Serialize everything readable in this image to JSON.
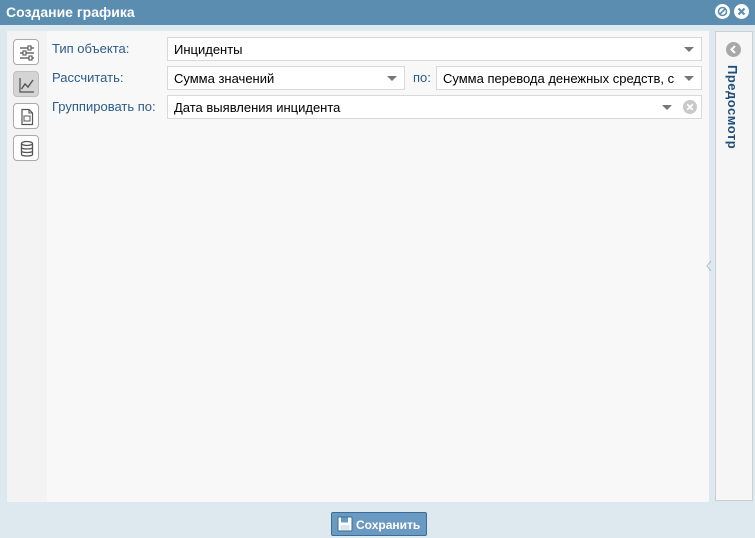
{
  "window": {
    "title": "Создание графика"
  },
  "toolbar": {
    "items": [
      "settings-sliders-icon",
      "line-chart-icon",
      "document-icon",
      "database-icon"
    ]
  },
  "form": {
    "object_type": {
      "label": "Тип объекта:",
      "value": "Инциденты"
    },
    "calculate": {
      "label": "Рассчитать:",
      "value": "Сумма значений",
      "by_label": "по:",
      "by_value": "Сумма перевода денежных средств, с"
    },
    "group_by": {
      "label": "Группировать по:",
      "value": "Дата выявления инцидента"
    }
  },
  "preview": {
    "label": "Предосмотр"
  },
  "footer": {
    "save_label": "Сохранить"
  },
  "colors": {
    "titlebar": "#5b8db0",
    "frame": "#dee8ef",
    "label": "#2b5b8b",
    "save_button": "#6a9ac2"
  }
}
